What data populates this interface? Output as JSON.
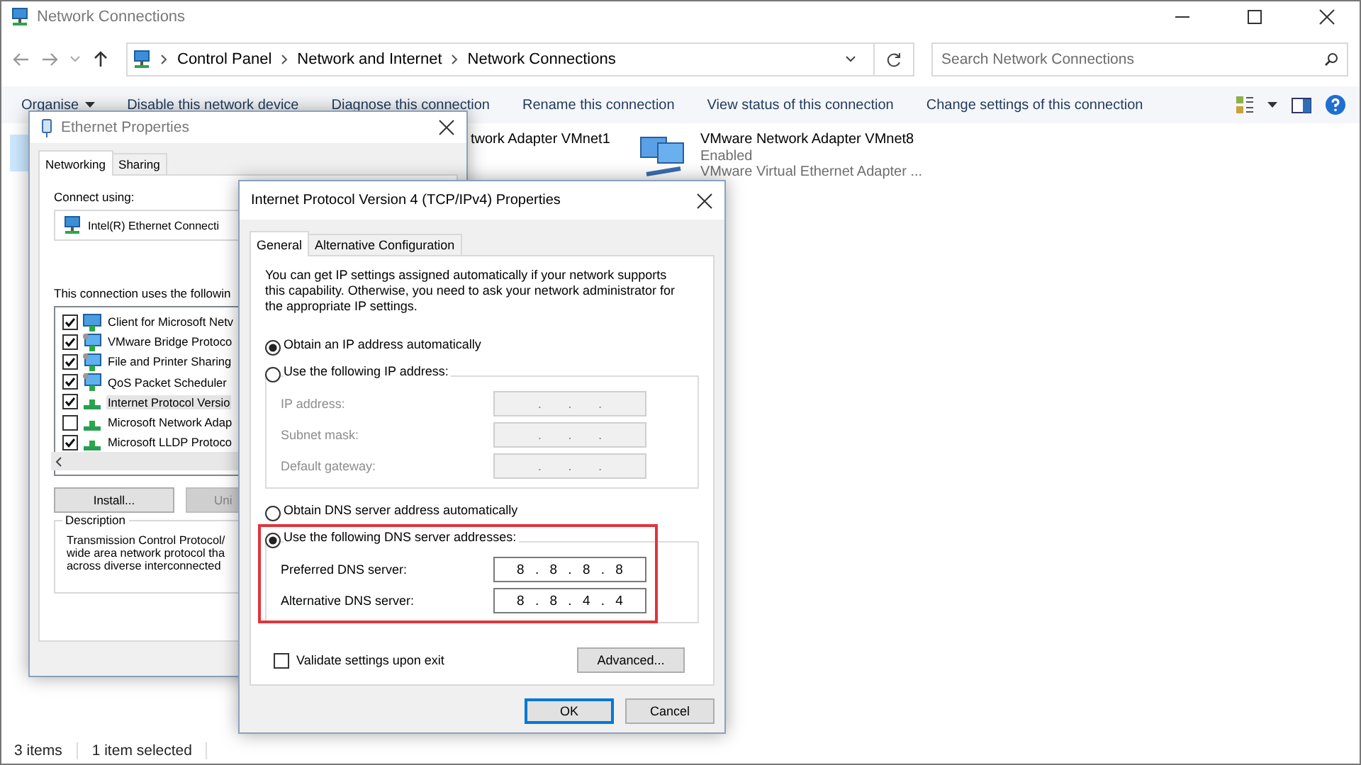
{
  "window": {
    "title": "Network Connections"
  },
  "address_bar": {
    "path": [
      "Control Panel",
      "Network and Internet",
      "Network Connections"
    ]
  },
  "search": {
    "placeholder": "Search Network Connections"
  },
  "toolbar": [
    {
      "label": "Organise",
      "kind": "menu"
    },
    {
      "label": "Disable this network device",
      "kind": "command"
    },
    {
      "label": "Diagnose this connection",
      "kind": "command"
    },
    {
      "label": "Rename this connection",
      "kind": "command"
    },
    {
      "label": "View status of this connection",
      "kind": "command"
    },
    {
      "label": "Change settings of this connection",
      "kind": "command"
    }
  ],
  "connections": [
    {
      "name": "twork Adapter VMnet1"
    },
    {
      "name": "VMware Network Adapter VMnet8",
      "status": "Enabled",
      "device": "VMware Virtual Ethernet Adapter ..."
    }
  ],
  "status_bar": {
    "count": "3 items",
    "selection": "1 item selected"
  },
  "ethernet_dialog": {
    "title": "Ethernet Properties",
    "tabs": [
      {
        "label": "Networking",
        "selected": true
      },
      {
        "label": "Sharing",
        "selected": false
      }
    ],
    "connect_label": "Connect using:",
    "adapter": "Intel(R) Ethernet Connecti",
    "components_label": "This connection uses the followin",
    "components": [
      {
        "name": "Client for Microsoft Netv",
        "kind": "client",
        "checked": true,
        "selected": false
      },
      {
        "name": "VMware Bridge Protoco",
        "kind": "service",
        "checked": true,
        "selected": false
      },
      {
        "name": "File and Printer Sharing",
        "kind": "service",
        "checked": true,
        "selected": false
      },
      {
        "name": "QoS Packet Scheduler",
        "kind": "service",
        "checked": true,
        "selected": false
      },
      {
        "name": "Internet Protocol Versio",
        "kind": "protocol",
        "checked": true,
        "selected": true
      },
      {
        "name": "Microsoft Network Adap",
        "kind": "protocol",
        "checked": false,
        "selected": false
      },
      {
        "name": "Microsoft LLDP Protoco",
        "kind": "protocol",
        "checked": true,
        "selected": false
      }
    ],
    "buttons": [
      "Install...",
      "Uni"
    ],
    "description_label": "Description",
    "description": [
      "Transmission Control Protocol/",
      "wide area network protocol tha",
      "across diverse interconnected"
    ]
  },
  "ipv4_dialog": {
    "title": "Internet Protocol Version 4 (TCP/IPv4) Properties",
    "tabs": [
      {
        "label": "General",
        "selected": true
      },
      {
        "label": "Alternative Configuration",
        "selected": false
      }
    ],
    "intro": "You can get IP settings assigned automatically if your network supports this capability. Otherwise, you need to ask your network administrator for the appropriate IP settings.",
    "ip_options": [
      {
        "label": "Obtain an IP address automatically",
        "selected": true
      },
      {
        "label": "Use the following IP address:",
        "selected": false
      }
    ],
    "ip_fields_disabled": true,
    "ip_fields": [
      {
        "label": "IP address:",
        "value": ". . ."
      },
      {
        "label": "Subnet mask:",
        "value": ". . ."
      },
      {
        "label": "Default gateway:",
        "value": ". . ."
      }
    ],
    "dns_options": [
      {
        "label": "Obtain DNS server address automatically",
        "selected": false
      },
      {
        "label": "Use the following DNS server addresses:",
        "selected": true
      }
    ],
    "dns_highlight": true,
    "dns_fields": [
      {
        "label": "Preferred DNS server:",
        "value": "8 . 8 . 8 . 8"
      },
      {
        "label": "Alternative DNS server:",
        "value": "8 . 8 . 4 . 4"
      }
    ],
    "validate": {
      "label": "Validate settings upon exit",
      "checked": false
    },
    "advanced": "Advanced...",
    "buttons": [
      {
        "label": "OK",
        "kind": "default"
      },
      {
        "label": "Cancel",
        "kind": "normal"
      }
    ]
  }
}
